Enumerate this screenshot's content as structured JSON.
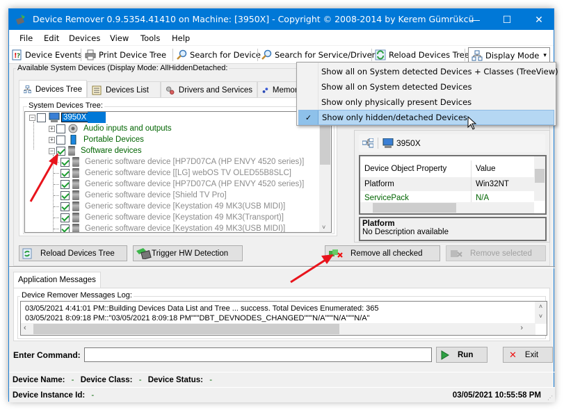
{
  "window": {
    "title": "Device Remover 0.9.5354.41410 on Machine: [3950X] - Copyright © 2008-2014 by Kerem Gümrükcü",
    "minimize": "—",
    "maximize": "☐",
    "close": "✕"
  },
  "menu": [
    "File",
    "Edit",
    "Devices",
    "View",
    "Tools",
    "Help"
  ],
  "toolbar": {
    "device_events": "Device Events",
    "print_tree": "Print Device Tree",
    "search_device": "Search for Device",
    "search_service": "Search for Service/Driver",
    "reload_tree": "Reload Devices Tree",
    "display_mode": "Display Mode",
    "display_mode_arrow": "▾"
  },
  "display_mode_menu": {
    "items": [
      {
        "label": "Show all on System detected Devices + Classes (TreeView)",
        "checked": false
      },
      {
        "label": "Show all on System detected Devices",
        "checked": false
      },
      {
        "label": "Show only physically present Devices",
        "checked": false
      },
      {
        "label": "Show only hidden/detached Devices",
        "checked": true
      }
    ],
    "check_mark": "✓"
  },
  "main": {
    "group_label": "Available System Devices (Display Mode: AllHiddenDetached:",
    "tabs": [
      {
        "label": "Devices Tree",
        "active": true
      },
      {
        "label": "Devices List",
        "active": false
      },
      {
        "label": "Drivers and Services",
        "active": false
      },
      {
        "label": "Memory L",
        "active": false
      }
    ],
    "tree_group_label": "System Devices Tree:",
    "tree": {
      "root": "3950X",
      "categories": [
        {
          "label": "Audio inputs and outputs",
          "checked": false,
          "expanded": false
        },
        {
          "label": "Portable Devices",
          "checked": false,
          "expanded": false
        },
        {
          "label": "Software devices",
          "checked": true,
          "expanded": true
        }
      ],
      "children": [
        "Generic software device [HP7D07CA (HP ENVY 4520 series)]",
        "Generic software device [[LG] webOS TV OLED55B8SLC]",
        "Generic software device [HP7D07CA (HP ENVY 4520 series)]",
        "Generic software device [Shield TV Pro]",
        "Generic software device [Keystation 49 MK3(USB MIDI)]",
        "Generic software device [Keystation 49 MK3(Transport)]",
        "Generic software device [Keystation 49 MK3(USB MIDI)]"
      ]
    }
  },
  "properties": {
    "header_device": "3950X",
    "columns": [
      "Device Object Property",
      "Value"
    ],
    "rows": [
      {
        "property": "Platform",
        "value": "Win32NT"
      },
      {
        "property": "ServicePack",
        "value": "N/A"
      }
    ],
    "description_title": "Platform",
    "description_text": "No Description available"
  },
  "buttons": {
    "reload_tree": "Reload Devices Tree",
    "trigger_hw": "Trigger HW Detection",
    "remove_all_checked": "Remove all checked",
    "remove_selected": "Remove selected"
  },
  "messages": {
    "tab_label": "Application Messages",
    "log_label": "Device Remover Messages Log:",
    "lines": [
      "03/05/2021 4:41:01 PM::Building Devices Data List and Tree ... success. Total Devices Enumerated: 365",
      "03/05/2021 8:09:18 PM::\"03/05/2021 8:09:18 PM\"\"\"DBT_DEVNODES_CHANGED\"\"\"N/A\"\"\"N/A\"\"\"N/A\""
    ]
  },
  "command": {
    "label": "Enter Command:",
    "value": "",
    "run": "Run",
    "exit": "Exit"
  },
  "status": {
    "device_name_label": "Device Name:",
    "device_name_value": "-",
    "device_class_label": "Device Class:",
    "device_class_value": "-",
    "device_status_label": "Device Status:",
    "device_status_value": "-",
    "instance_id_label": "Device Instance Id:",
    "instance_id_value": "-",
    "timestamp": "03/05/2021 10:55:58 PM"
  },
  "colors": {
    "titlebar": "#0078d7",
    "menu_selected": "#b5d7f3",
    "category_text": "#006400",
    "hidden_device_text": "#8c8c8c",
    "annotation_arrow": "#e8141c"
  }
}
